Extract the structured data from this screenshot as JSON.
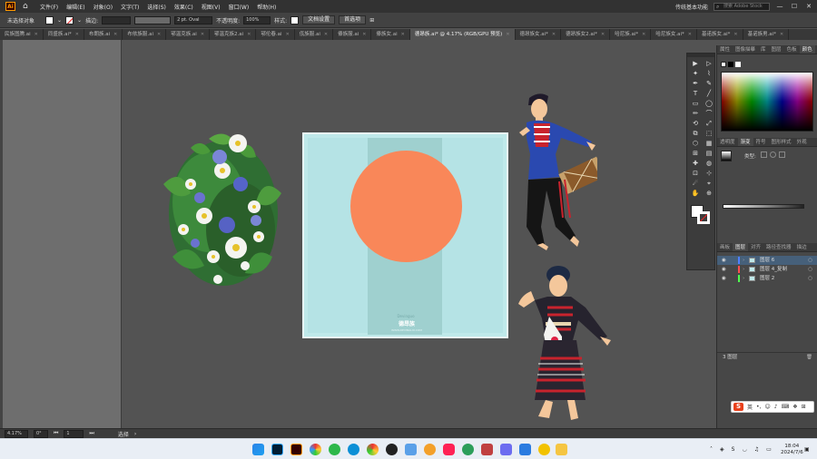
{
  "menubar": {
    "app_logo": "Ai",
    "items": [
      "文件(F)",
      "编辑(E)",
      "对象(O)",
      "文字(T)",
      "选择(S)",
      "效果(C)",
      "视图(V)",
      "窗口(W)",
      "帮助(H)"
    ],
    "workspace": "传统基本功能",
    "search_placeholder": "搜索 Adobe Stock",
    "window_buttons": [
      "—",
      "☐",
      "✕"
    ]
  },
  "controlbar": {
    "selection_label": "未选择对象",
    "stroke_label": "描边:",
    "stroke_value": "",
    "brush_value": "2 pt. Oval",
    "opacity_label": "不透明度:",
    "opacity_value": "100%",
    "style_label": "样式:",
    "doc_setup": "文档设置",
    "preferences": "首选项"
  },
  "tabs": [
    {
      "label": "民族图腾.ai",
      "active": false
    },
    {
      "label": "同盛族.ai*",
      "active": false
    },
    {
      "label": "布朗族.ai",
      "active": false
    },
    {
      "label": "布依族服.ai",
      "active": false
    },
    {
      "label": "鄂温克族.ai",
      "active": false
    },
    {
      "label": "鄂温克族2.ai",
      "active": false
    },
    {
      "label": "鄂伦春.ai",
      "active": false
    },
    {
      "label": "佤族服.ai",
      "active": false
    },
    {
      "label": "傣族服.ai",
      "active": false
    },
    {
      "label": "傣族女.ai",
      "active": false
    },
    {
      "label": "德昂族.ai* @ 4.17% (RGB/GPU 预览)",
      "active": true
    },
    {
      "label": "德昂族女.ai*",
      "active": false
    },
    {
      "label": "德昂族女2.ai*",
      "active": false
    },
    {
      "label": "哈尼族.ai*",
      "active": false
    },
    {
      "label": "哈尼族女.ai*",
      "active": false
    },
    {
      "label": "基诺族女.ai*",
      "active": false
    },
    {
      "label": "基诺族男.ai*",
      "active": false
    }
  ],
  "artboard": {
    "logo_small": "Devinguo",
    "logo_title": "德昂族",
    "logo_sub": "WWW.DEVINGUO.COM"
  },
  "tools": [
    "▶",
    "▷",
    "✦",
    "⌇",
    "✒",
    "✎",
    "T",
    "╱",
    "▭",
    "◯",
    "✏",
    "⌒",
    "⟲",
    "⤢",
    "⧉",
    "⬚",
    "⬡",
    "▦",
    "⊞",
    "▤",
    "✚",
    "◍",
    "⊡",
    "⊹",
    "☄",
    "⌖",
    "✋",
    "⊕"
  ],
  "tool_icon_names": [
    "selection",
    "direct-selection",
    "magic-wand",
    "lasso",
    "pen",
    "curvature",
    "type",
    "line",
    "rectangle",
    "ellipse",
    "pencil",
    "brush",
    "rotate",
    "scale",
    "shape-builder",
    "perspective",
    "mesh",
    "gradient",
    "eyedropper",
    "blend",
    "symbol-sprayer",
    "column-graph",
    "artboard",
    "slice",
    "eraser",
    "scissors",
    "hand",
    "zoom"
  ],
  "panels": {
    "color_tabs": [
      "属性",
      "图像描摹",
      "库",
      "图层",
      "色板",
      "颜色"
    ],
    "gradient_tabs": [
      "透明度",
      "渐变",
      "符号",
      "图形样式",
      "外观"
    ],
    "gradient_type_label": "类型:",
    "layers_tabs": [
      "画板",
      "图层",
      "对齐",
      "路径查找器",
      "描边"
    ],
    "layers": [
      {
        "name": "图层 6",
        "color": "#4f80ff",
        "selected": true
      },
      {
        "name": "图层 4_复制",
        "color": "#ff4f4f",
        "selected": false
      },
      {
        "name": "图层 2",
        "color": "#4fff4f",
        "selected": false
      }
    ],
    "layers_count": "3 图层"
  },
  "statusbar": {
    "zoom": "4.17%",
    "angle": "0°",
    "page": "1",
    "tool": "选择"
  },
  "taskbar": {
    "time": "18:04",
    "date": "2024/7/6",
    "ime_lang": "英"
  }
}
